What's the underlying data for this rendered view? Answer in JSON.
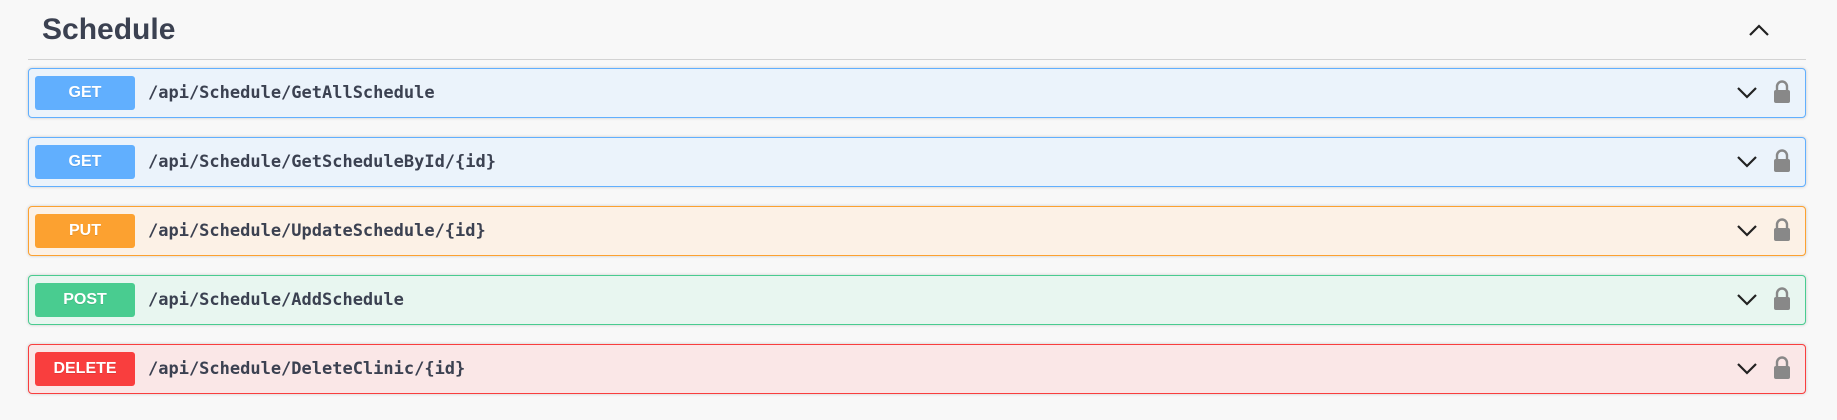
{
  "section": {
    "title": "Schedule",
    "toggle_icon": "chevron-up-icon"
  },
  "operations": [
    {
      "method": "GET",
      "path": "/api/Schedule/GetAllSchedule",
      "color": "#61affe"
    },
    {
      "method": "GET",
      "path": "/api/Schedule/GetScheduleById/{id}",
      "color": "#61affe"
    },
    {
      "method": "PUT",
      "path": "/api/Schedule/UpdateSchedule/{id}",
      "color": "#fca130"
    },
    {
      "method": "POST",
      "path": "/api/Schedule/AddSchedule",
      "color": "#49cc90"
    },
    {
      "method": "DELETE",
      "path": "/api/Schedule/DeleteClinic/{id}",
      "color": "#f93e3e"
    }
  ],
  "icons": {
    "expand": "chevron-down-icon",
    "auth": "lock-icon"
  },
  "colors": {
    "title_text": "#3b4151",
    "background": "#f8f8f8"
  }
}
